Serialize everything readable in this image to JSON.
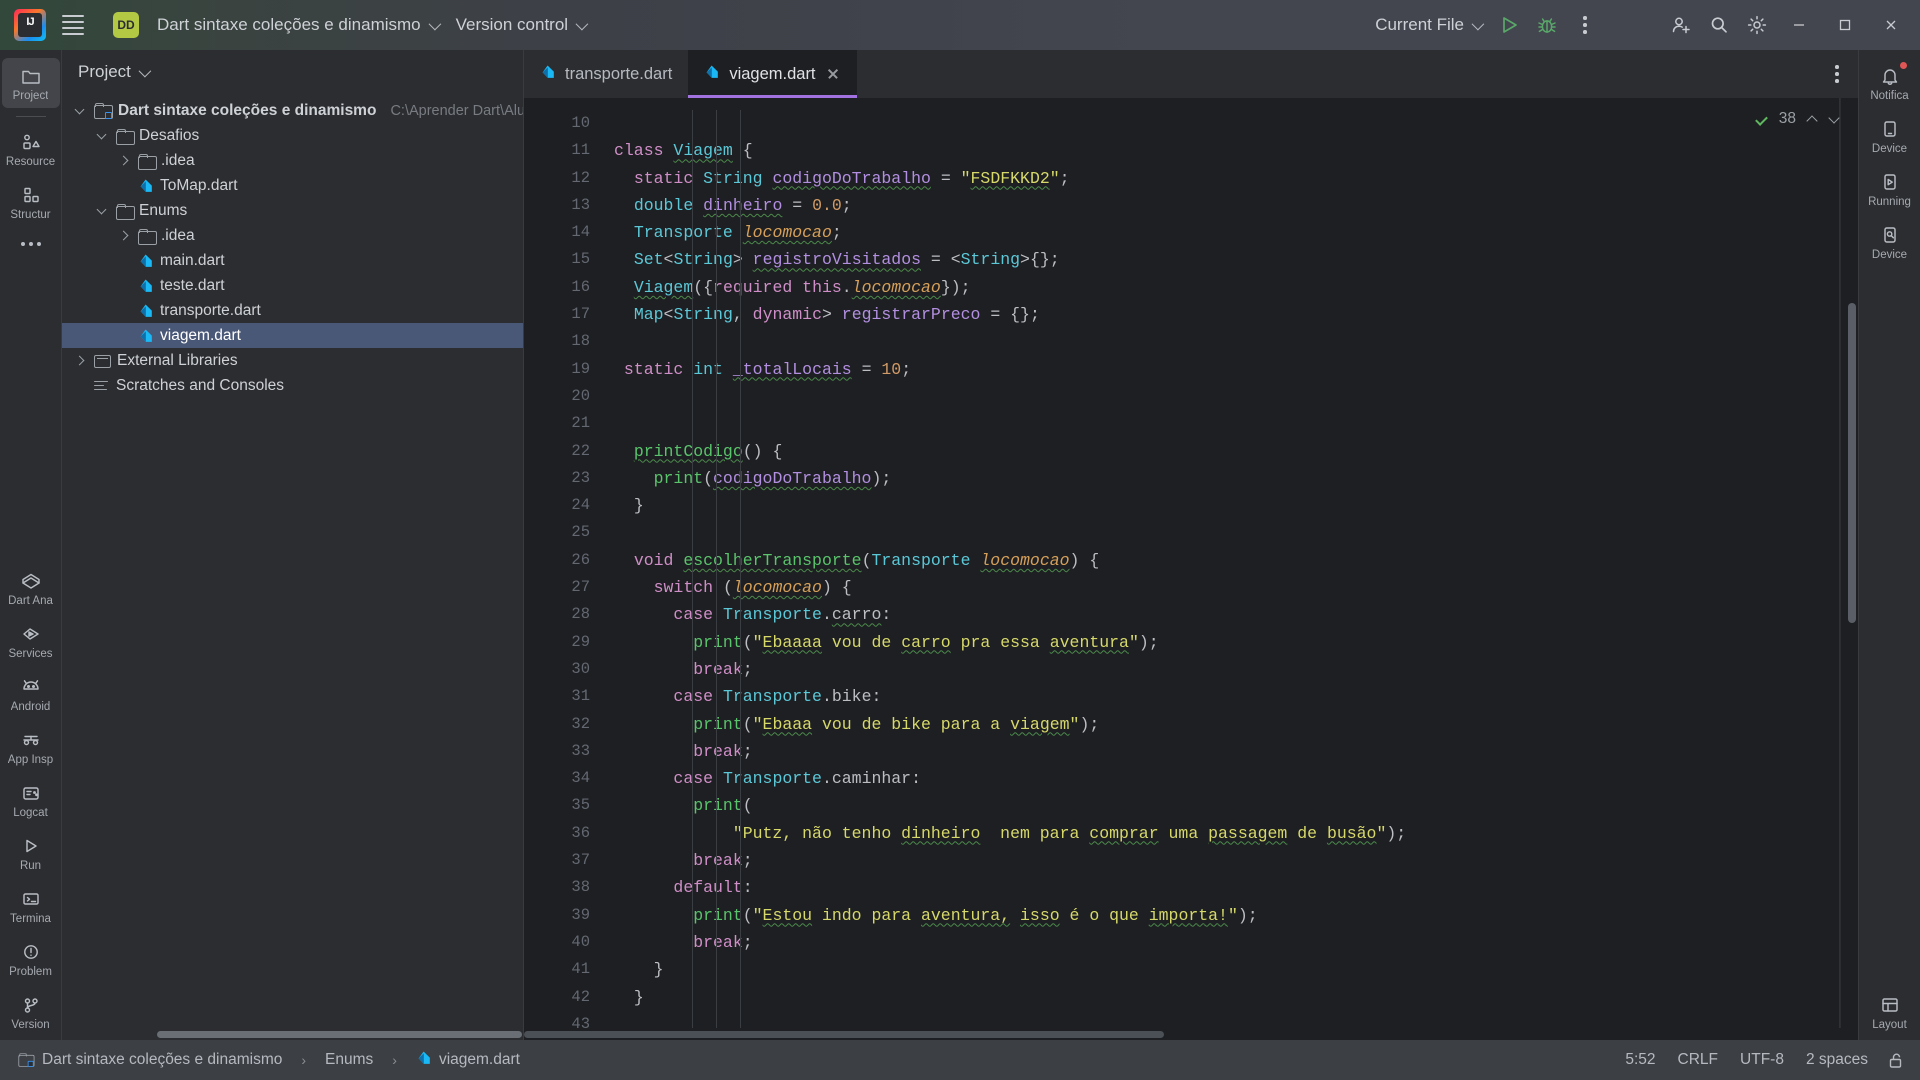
{
  "titlebar": {
    "logo_alt": "intellij-logo",
    "project_badge": "DD",
    "project_name": "Dart sintaxe coleções e dinamismo",
    "version_control": "Version control",
    "run_config": "Current File",
    "run_tooltip": "Run",
    "debug_tooltip": "Debug",
    "more_tooltip": "More Actions"
  },
  "left_rail": {
    "items": [
      {
        "label": "Project",
        "icon": "folder-icon",
        "active": true
      },
      {
        "label": "Resource",
        "icon": "resources-icon",
        "active": false
      },
      {
        "label": "Structur",
        "icon": "structure-icon",
        "active": false
      },
      {
        "label": "Dart Ana",
        "icon": "dart-analysis-icon",
        "active": false
      },
      {
        "label": "Services",
        "icon": "services-icon",
        "active": false
      },
      {
        "label": "Android",
        "icon": "android-icon",
        "active": false
      },
      {
        "label": "App Insp",
        "icon": "app-inspection-icon",
        "active": false
      },
      {
        "label": "Logcat",
        "icon": "logcat-icon",
        "active": false
      },
      {
        "label": "Run",
        "icon": "run-icon",
        "active": false
      },
      {
        "label": "Termina",
        "icon": "terminal-icon",
        "active": false
      },
      {
        "label": "Problem",
        "icon": "problems-icon",
        "active": false
      },
      {
        "label": "Version",
        "icon": "version-control-icon",
        "active": false
      }
    ]
  },
  "right_rail": {
    "items": [
      {
        "label": "Notifica",
        "icon": "notifications-icon",
        "badge": true
      },
      {
        "label": "Device",
        "icon": "device-manager-icon",
        "badge": false
      },
      {
        "label": "Running",
        "icon": "running-devices-icon",
        "badge": false
      },
      {
        "label": "Device",
        "icon": "device-file-explorer-icon",
        "badge": false
      },
      {
        "label": "Layout",
        "icon": "layout-inspector-icon",
        "badge": false
      }
    ]
  },
  "project_panel": {
    "title": "Project",
    "tree": [
      {
        "indent": 0,
        "arrow": "down",
        "icon": "module-icon",
        "label": "Dart sintaxe coleções e dinamismo",
        "path": "C:\\Aprender Dart\\Alura\\Dar",
        "selected": false,
        "bold": true
      },
      {
        "indent": 1,
        "arrow": "down",
        "icon": "folder-icon",
        "label": "Desafios",
        "path": "",
        "selected": false
      },
      {
        "indent": 2,
        "arrow": "right",
        "icon": "folder-icon",
        "label": ".idea",
        "path": "",
        "selected": false
      },
      {
        "indent": 2,
        "arrow": "none",
        "icon": "dart-file-icon",
        "label": "ToMap.dart",
        "path": "",
        "selected": false
      },
      {
        "indent": 1,
        "arrow": "down",
        "icon": "folder-icon",
        "label": "Enums",
        "path": "",
        "selected": false
      },
      {
        "indent": 2,
        "arrow": "right",
        "icon": "folder-icon",
        "label": ".idea",
        "path": "",
        "selected": false
      },
      {
        "indent": 2,
        "arrow": "none",
        "icon": "dart-file-icon",
        "label": "main.dart",
        "path": "",
        "selected": false
      },
      {
        "indent": 2,
        "arrow": "none",
        "icon": "dart-file-icon",
        "label": "teste.dart",
        "path": "",
        "selected": false
      },
      {
        "indent": 2,
        "arrow": "none",
        "icon": "dart-file-icon",
        "label": "transporte.dart",
        "path": "",
        "selected": false
      },
      {
        "indent": 2,
        "arrow": "none",
        "icon": "dart-file-icon",
        "label": "viagem.dart",
        "path": "",
        "selected": true
      },
      {
        "indent": 0,
        "arrow": "right",
        "icon": "library-icon",
        "label": "External Libraries",
        "path": "",
        "selected": false
      },
      {
        "indent": 0,
        "arrow": "none",
        "icon": "scratches-icon",
        "label": "Scratches and Consoles",
        "path": "",
        "selected": false
      }
    ]
  },
  "editor": {
    "tabs": [
      {
        "label": "transporte.dart",
        "icon": "dart-file-icon",
        "active": false,
        "closable": false
      },
      {
        "label": "viagem.dart",
        "icon": "dart-file-icon",
        "active": true,
        "closable": true
      }
    ],
    "inspection": {
      "count": "38",
      "check_icon": "checkmark-icon",
      "up_icon": "caret-up-icon",
      "down_icon": "caret-down-icon"
    },
    "first_line_number": 10,
    "lines": [
      {
        "n": 10,
        "text": ""
      },
      {
        "n": 11,
        "text": "class Viagem {"
      },
      {
        "n": 12,
        "text": "  static String codigoDoTrabalho = \"FSDFKKD2\";"
      },
      {
        "n": 13,
        "text": "  double dinheiro = 0.0;"
      },
      {
        "n": 14,
        "text": "  Transporte locomocao;"
      },
      {
        "n": 15,
        "text": "  Set<String> registroVisitados = <String>{};"
      },
      {
        "n": 16,
        "text": "  Viagem({required this.locomocao});"
      },
      {
        "n": 17,
        "text": "  Map<String, dynamic> registrarPreco = {};"
      },
      {
        "n": 18,
        "text": ""
      },
      {
        "n": 19,
        "text": " static int _totalLocais = 10;"
      },
      {
        "n": 20,
        "text": ""
      },
      {
        "n": 21,
        "text": ""
      },
      {
        "n": 22,
        "text": "  printCodigo() {"
      },
      {
        "n": 23,
        "text": "    print(codigoDoTrabalho);"
      },
      {
        "n": 24,
        "text": "  }"
      },
      {
        "n": 25,
        "text": ""
      },
      {
        "n": 26,
        "text": "  void escolherTransporte(Transporte locomocao) {"
      },
      {
        "n": 27,
        "text": "    switch (locomocao) {"
      },
      {
        "n": 28,
        "text": "      case Transporte.carro:"
      },
      {
        "n": 29,
        "text": "        print(\"Ebaaaa vou de carro pra essa aventura\");"
      },
      {
        "n": 30,
        "text": "        break;"
      },
      {
        "n": 31,
        "text": "      case Transporte.bike:"
      },
      {
        "n": 32,
        "text": "        print(\"Ebaaa vou de bike para a viagem\");"
      },
      {
        "n": 33,
        "text": "        break;"
      },
      {
        "n": 34,
        "text": "      case Transporte.caminhar:"
      },
      {
        "n": 35,
        "text": "        print("
      },
      {
        "n": 36,
        "text": "            \"Putz, não tenho dinheiro  nem para comprar uma passagem de busão\");"
      },
      {
        "n": 37,
        "text": "        break;"
      },
      {
        "n": 38,
        "text": "      default:"
      },
      {
        "n": 39,
        "text": "        print(\"Estou indo para aventura, isso é o que importa!\");"
      },
      {
        "n": 40,
        "text": "        break;"
      },
      {
        "n": 41,
        "text": "    }"
      },
      {
        "n": 42,
        "text": "  }"
      },
      {
        "n": 43,
        "text": ""
      }
    ]
  },
  "statusbar": {
    "breadcrumb": [
      {
        "label": "Dart sintaxe coleções e dinamismo",
        "icon": "module-icon"
      },
      {
        "label": "Enums",
        "icon": "none"
      },
      {
        "label": "viagem.dart",
        "icon": "dart-file-icon"
      }
    ],
    "separator": "›",
    "caret": "5:52",
    "line_ending": "CRLF",
    "encoding": "UTF-8",
    "indent": "2 spaces",
    "lock_icon": "unlocked-icon"
  },
  "colors": {
    "accent_tab": "#a273e0",
    "selection": "#4a5878",
    "editor_bg": "#1e1f22",
    "panel_bg": "#2b2d30",
    "titlebar_bg": "#43454f",
    "statusbar_bg": "#3c3f44",
    "dart_blue": "#1ab9f5",
    "run_green": "#59a869",
    "badge_green": "#b3c944",
    "keyword": "#cf8ec7",
    "type": "#5bc8d8",
    "string": "#d6d86a",
    "number": "#d19a66",
    "function": "#59c46b",
    "field": "#b28fe0",
    "param": "#d6a05a"
  }
}
